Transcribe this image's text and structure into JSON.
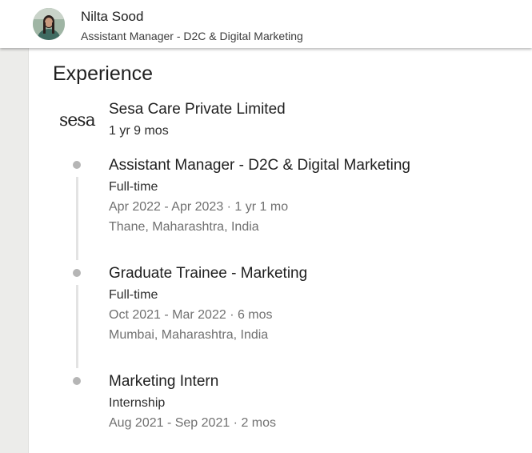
{
  "header": {
    "name": "Nilta Sood",
    "headline": "Assistant Manager - D2C & Digital Marketing"
  },
  "experience": {
    "section_title": "Experience",
    "company": {
      "logo_text": "sesa",
      "name": "Sesa Care Private Limited",
      "duration": "1 yr 9 mos"
    },
    "roles": [
      {
        "title": "Assistant Manager - D2C & Digital Marketing",
        "type": "Full-time",
        "dates": "Apr 2022 - Apr 2023 · 1 yr 1 mo",
        "location": "Thane, Maharashtra, India"
      },
      {
        "title": "Graduate Trainee - Marketing",
        "type": "Full-time",
        "dates": "Oct 2021 - Mar 2022 · 6 mos",
        "location": "Mumbai, Maharashtra, India"
      },
      {
        "title": "Marketing Intern",
        "type": "Internship",
        "dates": "Aug 2021 - Sep 2021 · 2 mos"
      }
    ]
  },
  "colors": {
    "background": "#f3f2ef",
    "timeline_dot": "#b5b5b5",
    "timeline_line": "#e3e3e3",
    "secondary_text": "#707070"
  }
}
